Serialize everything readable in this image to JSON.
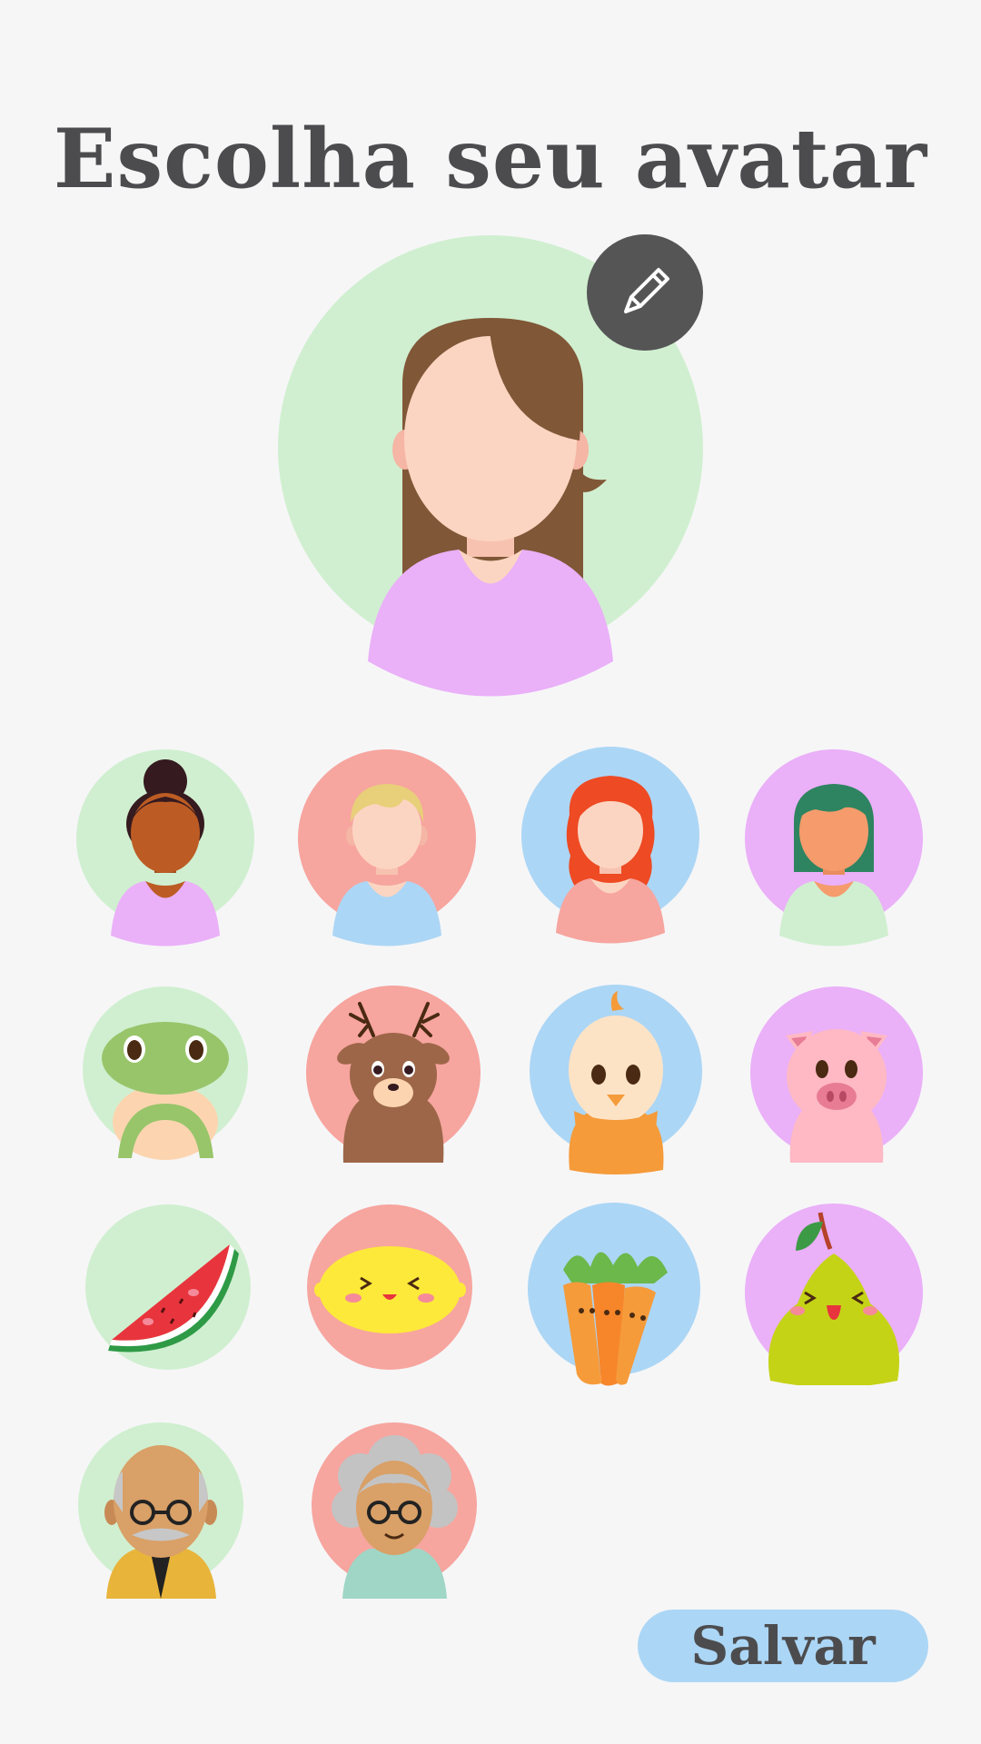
{
  "page": {
    "title": "Escolha seu avatar"
  },
  "selected_avatar": {
    "name": "woman-brown-hair-avatar",
    "background": "#d0efd0"
  },
  "avatars": [
    {
      "name": "woman-hair-bun-avatar",
      "background": "#d0efd0"
    },
    {
      "name": "boy-blond-avatar",
      "background": "#f7a59f"
    },
    {
      "name": "woman-red-hair-avatar",
      "background": "#acd6f5"
    },
    {
      "name": "person-green-hair-avatar",
      "background": "#eab0f8"
    },
    {
      "name": "frog-avatar",
      "background": "#d0efd0"
    },
    {
      "name": "deer-avatar",
      "background": "#f7a59f"
    },
    {
      "name": "chick-avatar",
      "background": "#acd6f5"
    },
    {
      "name": "pig-avatar",
      "background": "#eab0f8"
    },
    {
      "name": "watermelon-avatar",
      "background": "#d0efd0"
    },
    {
      "name": "lemon-avatar",
      "background": "#f7a59f"
    },
    {
      "name": "carrots-avatar",
      "background": "#acd6f5"
    },
    {
      "name": "pear-avatar",
      "background": "#eab0f8"
    },
    {
      "name": "grandpa-avatar",
      "background": "#d0efd0"
    },
    {
      "name": "grandma-avatar",
      "background": "#f7a59f"
    }
  ],
  "buttons": {
    "save": "Salvar",
    "edit_icon": "pencil-icon"
  },
  "colors": {
    "background": "#f6f6f7",
    "title": "#4c4c4e",
    "edit_button": "#555556",
    "save_button": "#acd6f5"
  }
}
